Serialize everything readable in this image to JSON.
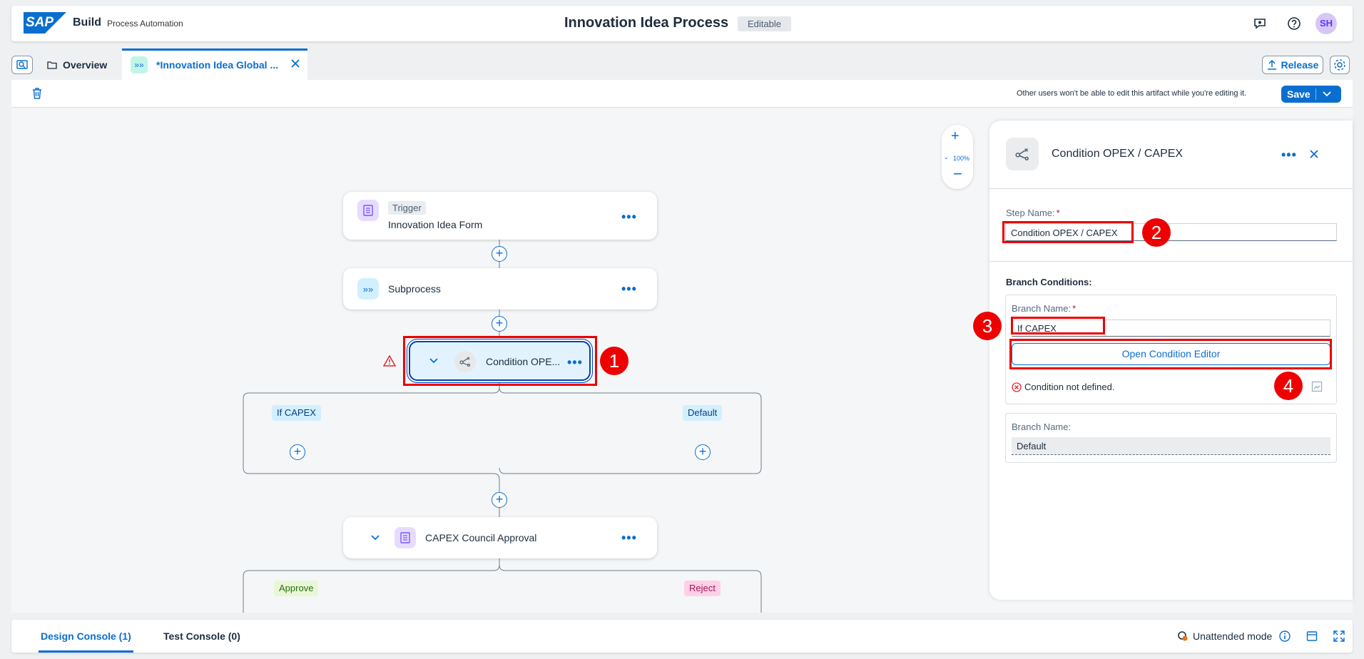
{
  "shell": {
    "logo": "SAP",
    "product": "Build",
    "subproduct": "Process Automation",
    "title": "Innovation Idea Process",
    "status_badge": "Editable",
    "avatar_initials": "SH"
  },
  "tabs": {
    "overview": "Overview",
    "active_tab": "*Innovation Idea Global ...",
    "release": "Release"
  },
  "toolbar": {
    "notice": "Other users won't be able to edit this artifact while you're editing it.",
    "save": "Save"
  },
  "zoom": {
    "level": "100%"
  },
  "flow": {
    "trigger_tag": "Trigger",
    "trigger_name": "Innovation Idea Form",
    "subprocess": "Subprocess",
    "condition": "Condition OPE...",
    "branch_left": "If CAPEX",
    "branch_right": "Default",
    "approval": "CAPEX Council Approval",
    "outcome_left": "Approve",
    "outcome_right": "Reject"
  },
  "panel": {
    "title": "Condition OPEX / CAPEX",
    "step_name_label": "Step Name:",
    "required_mark": "*",
    "step_name_value": "Condition OPEX / CAPEX",
    "branch_conditions": "Branch Conditions:",
    "branch_name_label": "Branch Name:",
    "branch1_value": "If CAPEX",
    "open_editor": "Open Condition Editor",
    "condition_error": "Condition not defined.",
    "branch2_label": "Branch Name:",
    "branch2_value": "Default"
  },
  "annotations": {
    "n1": "1",
    "n2": "2",
    "n3": "3",
    "n4": "4"
  },
  "console": {
    "design": "Design Console (1)",
    "test": "Test Console (0)",
    "mode": "Unattended mode"
  },
  "colors": {
    "accent": "#0a6ed1",
    "annotation": "#ee0000",
    "error": "#e9282c"
  }
}
